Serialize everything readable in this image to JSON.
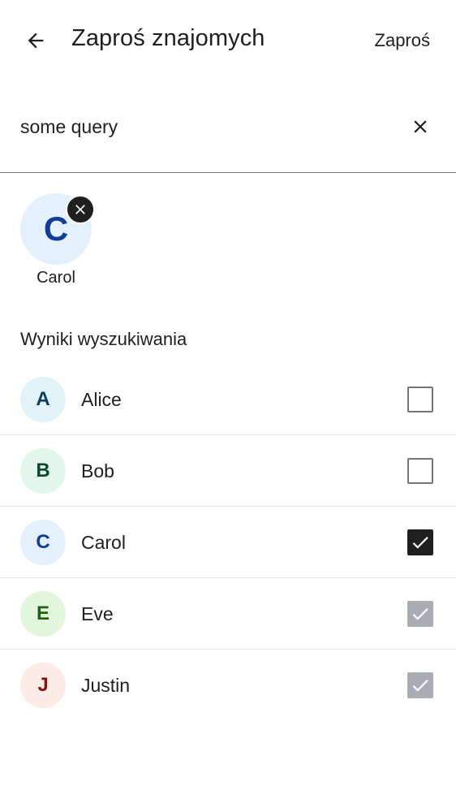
{
  "header": {
    "title": "Zaproś znajomych",
    "action_label": "Zaproś"
  },
  "search": {
    "value": "some query",
    "placeholder": ""
  },
  "selected": [
    {
      "initial": "C",
      "name": "Carol",
      "avatar_bg": "#e5f0fd",
      "avatar_fg": "#0f3d9a"
    }
  ],
  "section_title": "Wyniki wyszukiwania",
  "results": [
    {
      "initial": "A",
      "name": "Alice",
      "state": "unchecked",
      "avatar_bg": "#e1f3f8",
      "avatar_fg": "#0b3e5e"
    },
    {
      "initial": "B",
      "name": "Bob",
      "state": "unchecked",
      "avatar_bg": "#e2f6ec",
      "avatar_fg": "#0a4a2c"
    },
    {
      "initial": "C",
      "name": "Carol",
      "state": "checked",
      "avatar_bg": "#e5f0fd",
      "avatar_fg": "#0f3d9a"
    },
    {
      "initial": "E",
      "name": "Eve",
      "state": "disabled-checked",
      "avatar_bg": "#e1f6dc",
      "avatar_fg": "#1f5f12"
    },
    {
      "initial": "J",
      "name": "Justin",
      "state": "disabled-checked",
      "avatar_bg": "#fdece5",
      "avatar_fg": "#8a1010"
    }
  ],
  "icons": {
    "back": "arrow-back-icon",
    "clear": "close-icon",
    "remove": "close-icon",
    "check": "check-icon"
  }
}
